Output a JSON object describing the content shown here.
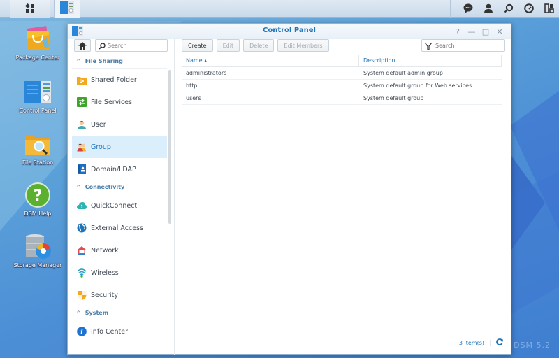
{
  "taskbar": {
    "main_menu_icon": "grid-menu-icon",
    "open_app_icon": "control-panel-icon",
    "right_icons": [
      "chat-icon",
      "user-icon",
      "search-icon",
      "widgets-icon",
      "layout-icon"
    ]
  },
  "desktop": {
    "icons": [
      {
        "label": "Package Center",
        "icon": "package-center-icon"
      },
      {
        "label": "Control Panel",
        "icon": "control-panel-icon"
      },
      {
        "label": "File Station",
        "icon": "file-station-icon"
      },
      {
        "label": "DSM Help",
        "icon": "help-icon"
      },
      {
        "label": "Storage Manager",
        "icon": "storage-manager-icon"
      }
    ],
    "watermark": "DSM 5.2"
  },
  "window": {
    "title": "Control Panel",
    "controls": {
      "help": "?",
      "minimize": "—",
      "maximize": "□",
      "close": "✕"
    }
  },
  "sidebar": {
    "search_placeholder": "Search",
    "sections": [
      {
        "title": "File Sharing",
        "items": [
          {
            "label": "Shared Folder",
            "icon": "shared-folder-icon",
            "active": false
          },
          {
            "label": "File Services",
            "icon": "file-services-icon",
            "active": false
          },
          {
            "label": "User",
            "icon": "user-icon",
            "active": false
          },
          {
            "label": "Group",
            "icon": "group-icon",
            "active": true
          },
          {
            "label": "Domain/LDAP",
            "icon": "domain-ldap-icon",
            "active": false
          }
        ]
      },
      {
        "title": "Connectivity",
        "items": [
          {
            "label": "QuickConnect",
            "icon": "quickconnect-icon",
            "active": false
          },
          {
            "label": "External Access",
            "icon": "external-access-icon",
            "active": false
          },
          {
            "label": "Network",
            "icon": "network-icon",
            "active": false
          },
          {
            "label": "Wireless",
            "icon": "wireless-icon",
            "active": false
          },
          {
            "label": "Security",
            "icon": "security-icon",
            "active": false
          }
        ]
      },
      {
        "title": "System",
        "items": [
          {
            "label": "Info Center",
            "icon": "info-center-icon",
            "active": false
          }
        ]
      }
    ]
  },
  "toolbar": {
    "create": "Create",
    "edit": "Edit",
    "delete": "Delete",
    "edit_members": "Edit Members",
    "search_placeholder": "Search"
  },
  "grid": {
    "columns": {
      "name": "Name ▴",
      "description": "Description"
    },
    "rows": [
      {
        "name": "administrators",
        "description": "System default admin group"
      },
      {
        "name": "http",
        "description": "System default group for Web services"
      },
      {
        "name": "users",
        "description": "System default group"
      }
    ]
  },
  "status": {
    "count": "3 item(s)",
    "refresh": "C"
  }
}
